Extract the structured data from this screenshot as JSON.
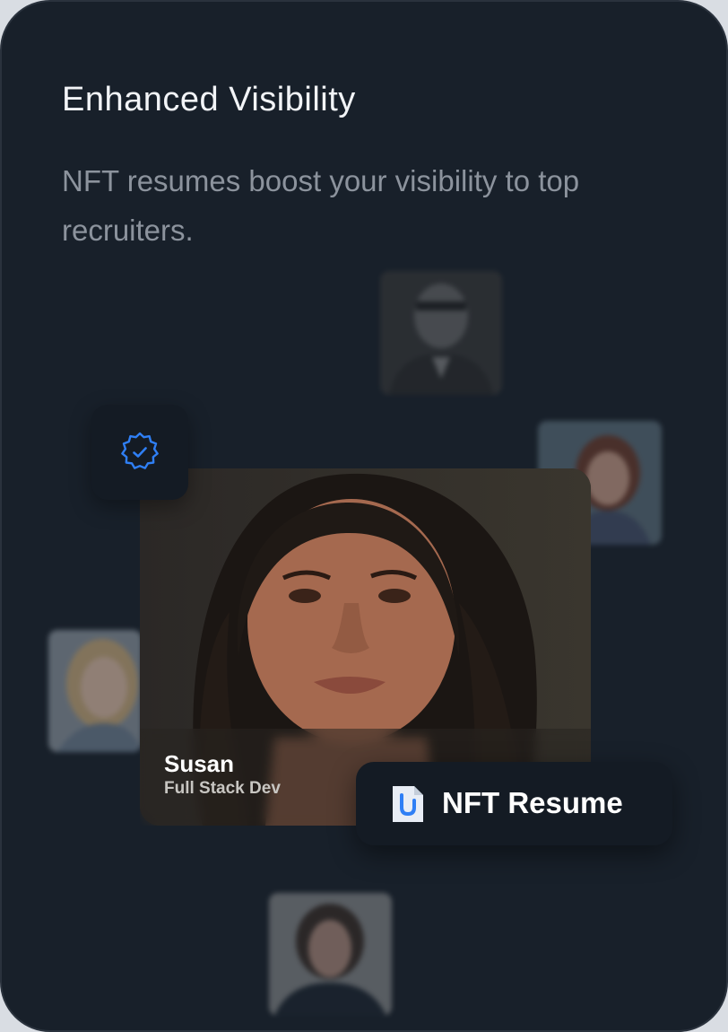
{
  "card": {
    "title": "Enhanced Visibility",
    "subtitle": "NFT resumes boost your visibility to top recruiters."
  },
  "profile": {
    "name": "Susan",
    "role": "Full Stack Dev"
  },
  "nft_button": {
    "label": "NFT Resume",
    "icon": "document-icon"
  },
  "badge": {
    "icon": "verified-check-icon"
  },
  "colors": {
    "background": "#18202a",
    "tile": "#141b24",
    "accent": "#2f7ff5",
    "title": "#f2f4f7",
    "subtitle": "#8c939d"
  }
}
